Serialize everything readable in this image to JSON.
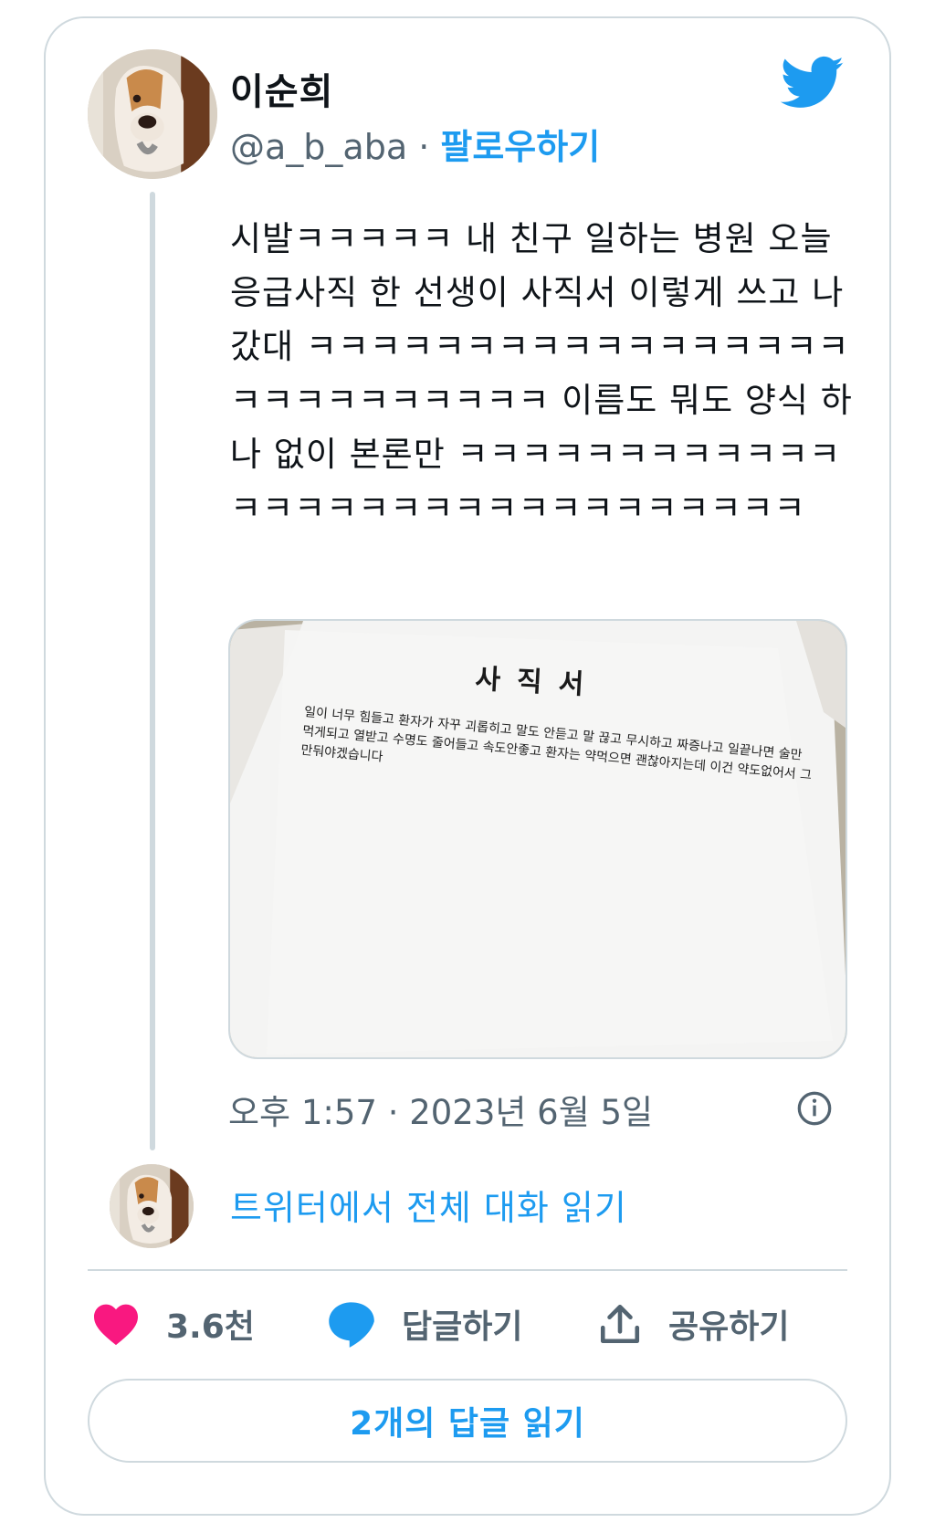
{
  "author": {
    "display_name": "이순희",
    "handle": "@a_b_aba",
    "separator": "·",
    "follow_label": "팔로우하기"
  },
  "tweet": {
    "text": "시발ㅋㅋㅋㅋㅋ 내 친구 일하는 병원 오늘 응급사직 한 선생이 사직서 이렇게 쓰고 나갔대 ㅋㅋㅋㅋㅋㅋㅋㅋㅋㅋㅋㅋㅋㅋㅋㅋㅋㅋㅋㅋㅋㅋㅋㅋㅋㅋㅋ 이름도 뭐도 양식 하나 없이 본론만 ㅋㅋㅋㅋㅋㅋㅋㅋㅋㅋㅋㅋㅋㅋㅋㅋㅋㅋㅋㅋㅋㅋㅋㅋㅋㅋㅋㅋㅋㅋ",
    "timestamp": "오후 1:57 · 2023년 6월 5일"
  },
  "media": {
    "doc_title": "사직서",
    "doc_body": "일이 너무 힘들고 환자가 자꾸 괴롭히고 말도 안듣고 말 끊고 무시하고 짜증나고 일끝나면 술만먹게되고 열받고 수명도 줄어들고 속도안좋고 환자는 약먹으면 괜찮아지는데 이건 약도없어서 그만둬야겠습니다"
  },
  "conversation": {
    "read_full_label": "트위터에서 전체 대화 읽기"
  },
  "actions": {
    "like_count": "3.6천",
    "reply_label": "답글하기",
    "share_label": "공유하기"
  },
  "replies_button_label": "2개의 답글 읽기",
  "colors": {
    "accent": "#1d9bf0",
    "like": "#f91880",
    "secondary_text": "#536471",
    "border": "#cfd9de"
  },
  "icons": {
    "brand": "twitter-bird-icon",
    "info": "info-icon",
    "like": "heart-icon",
    "reply": "speech-bubble-icon",
    "share": "share-upload-icon"
  }
}
